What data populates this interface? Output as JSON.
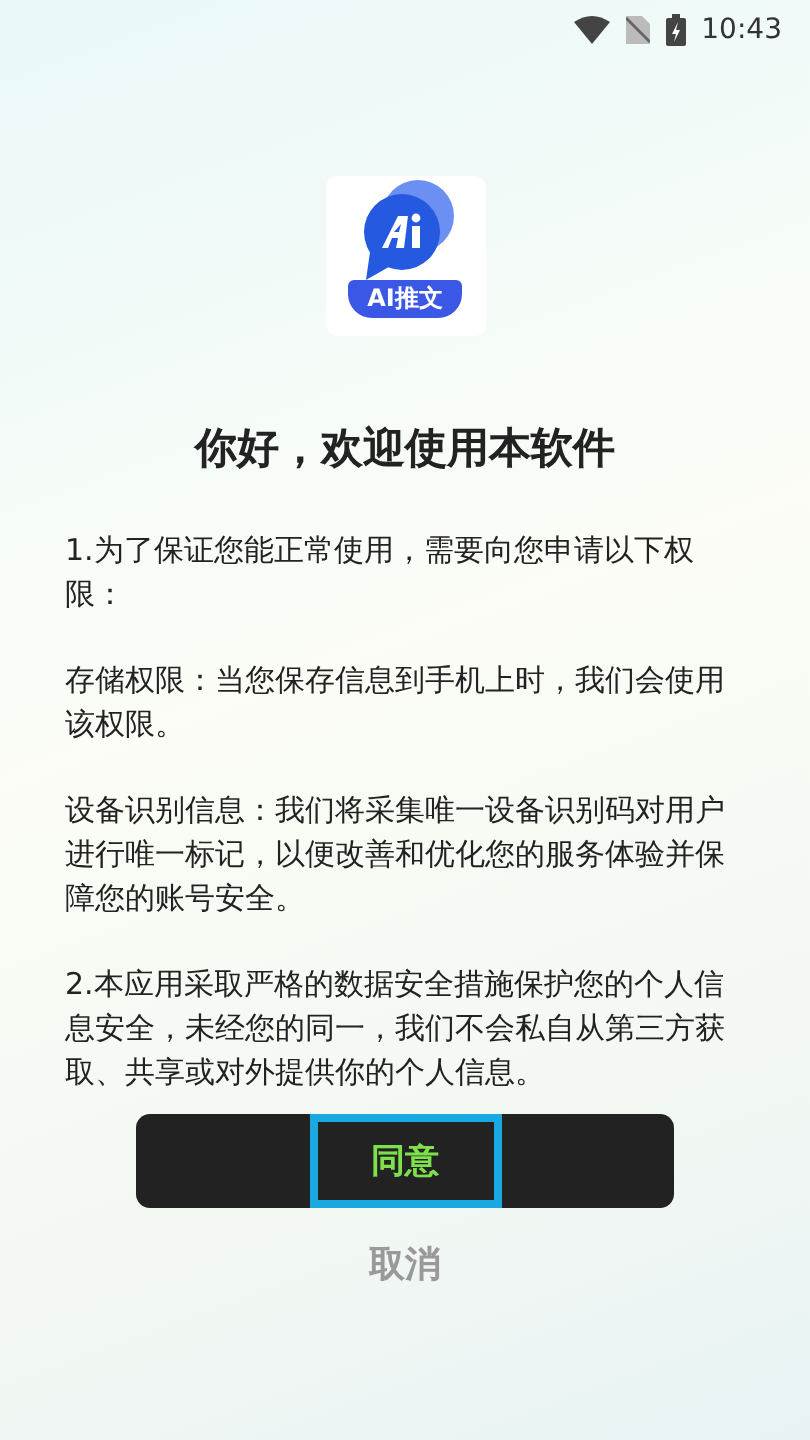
{
  "status_bar": {
    "time": "10:43"
  },
  "logo": {
    "label": "AI推文"
  },
  "title": "你好，欢迎使用本软件",
  "paragraphs": [
    "1.为了保证您能正常使用，需要向您申请以下权限：",
    "存储权限：当您保存信息到手机上时，我们会使用该权限。",
    "设备识别信息：我们将采集唯一设备识别码对用户进行唯一标记，以便改善和优化您的服务体验并保障您的账号安全。",
    "2.本应用采取严格的数据安全措施保护您的个人信息安全，未经您的同一，我们不会私自从第三方获取、共享或对外提供你的个人信息。"
  ],
  "buttons": [
    {
      "kind": "agree",
      "label": "同意",
      "focused": true
    },
    {
      "kind": "cancel",
      "label": "取消",
      "focused": false
    }
  ]
}
